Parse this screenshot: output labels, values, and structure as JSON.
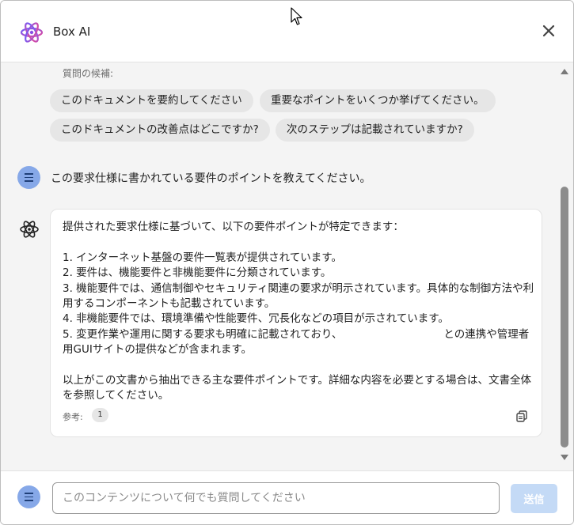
{
  "header": {
    "title": "Box AI",
    "logo_icon": "box-ai-atom-icon",
    "close_icon": "close-icon"
  },
  "suggestions": {
    "label": "質問の候補:",
    "chips": [
      "このドキュメントを要約してください",
      "重要なポイントをいくつか挙げてください。",
      "このドキュメントの改善点はどこですか?",
      "次のステップは記載されていますか?"
    ]
  },
  "user_message": {
    "text": "この要求仕様に書かれている要件のポイントを教えてください。"
  },
  "ai_response": {
    "intro": "提供された要求仕様に基づいて、以下の要件ポイントが特定できます：",
    "points": [
      "1. インターネット基盤の要件一覧表が提供されています。",
      "2. 要件は、機能要件と非機能要件に分類されています。",
      "3. 機能要件では、通信制御やセキュリティ関連の要求が明示されています。具体的な制御方法や利用するコンポーネントも記載されています。",
      "4. 非機能要件では、環境準備や性能要件、冗長化などの項目が示されています。",
      "5. 変更作業や運用に関する要求も明確に記載されており、",
      "との連携や管理者用GUIサイトの提供などが含まれます。"
    ],
    "conclusion": "以上がこの文書から抽出できる主な要件ポイントです。詳細な内容を必要とする場合は、文書全体を参照してください。",
    "ref_label": "参考:",
    "ref_number": "1"
  },
  "composer": {
    "placeholder": "このコンテンツについて何でも質問してください",
    "value": "",
    "send_label": "送信"
  },
  "colors": {
    "accent": "#86a8e8",
    "send_disabled": "#c4daf6",
    "panel_bg": "#f4f4f4"
  }
}
